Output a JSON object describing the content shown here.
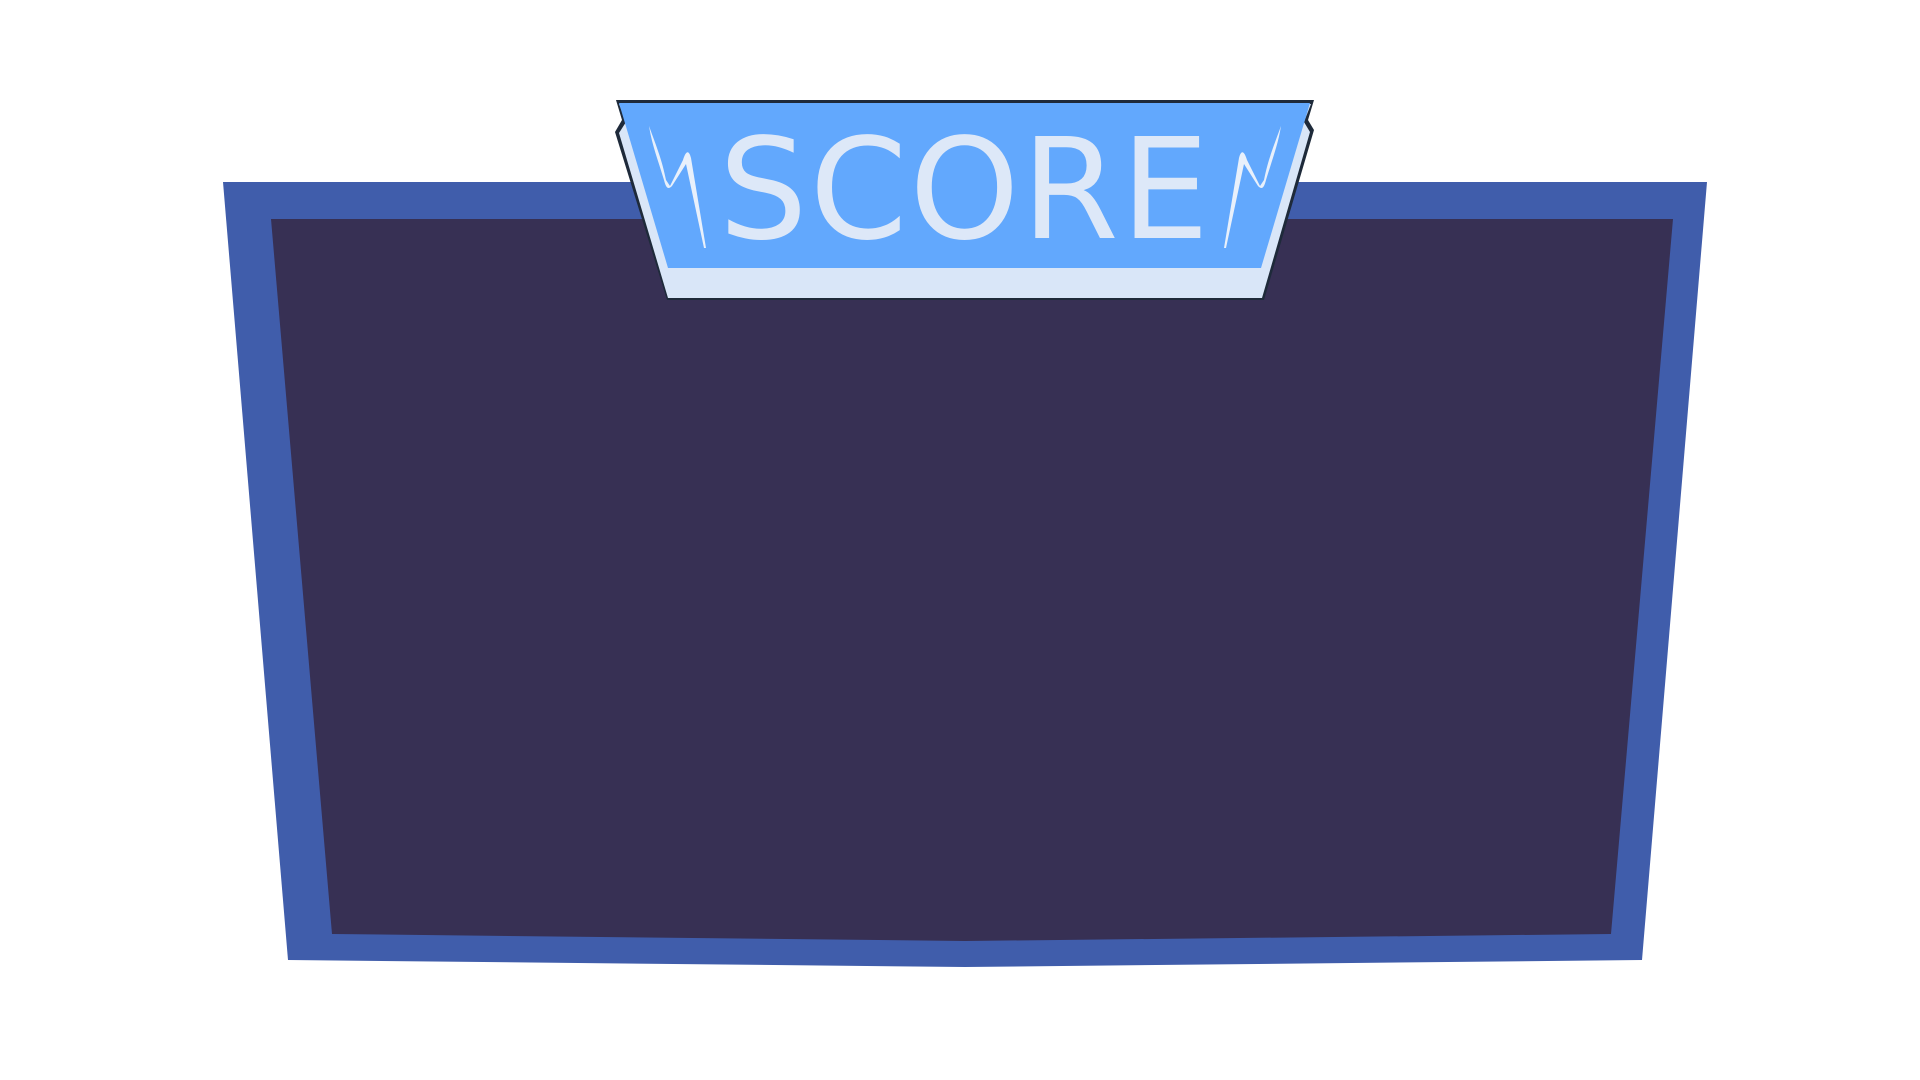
{
  "scoreboard": {
    "title": "SCORE"
  },
  "colors": {
    "background": "#ffffff",
    "frame_outer": "#405dab",
    "frame_inner": "#373054",
    "banner_face": "#62a8fd",
    "banner_edge": "#d9e6f8",
    "banner_text": "#dde8f8",
    "banner_outline": "#1e2a3a",
    "spark": "#e8f0fb"
  },
  "icons": {
    "left_ornament": "spark-icon",
    "right_ornament": "spark-icon"
  }
}
